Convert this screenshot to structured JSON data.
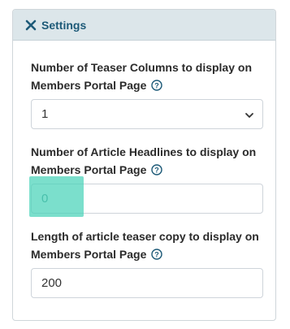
{
  "panel": {
    "title": "Settings",
    "close_icon": "close-x-icon"
  },
  "fields": [
    {
      "label_line1": "Number of Teaser Columns to display on",
      "label_line2": "Members Portal Page",
      "control": "select",
      "value": "1",
      "help_icon": "question-circle-icon"
    },
    {
      "label_line1": "Number of Article Headlines to display on",
      "label_line2": "Members Portal Page",
      "control": "input",
      "value": "0",
      "help_icon": "question-circle-icon"
    },
    {
      "label_line1": "Length of article teaser copy to display on",
      "label_line2": "Members Portal Page",
      "control": "input",
      "value": "200",
      "help_icon": "question-circle-icon"
    }
  ],
  "colors": {
    "header_bg": "#dce6ea",
    "header_text": "#1d5a78",
    "highlight": "#48d2b9"
  }
}
